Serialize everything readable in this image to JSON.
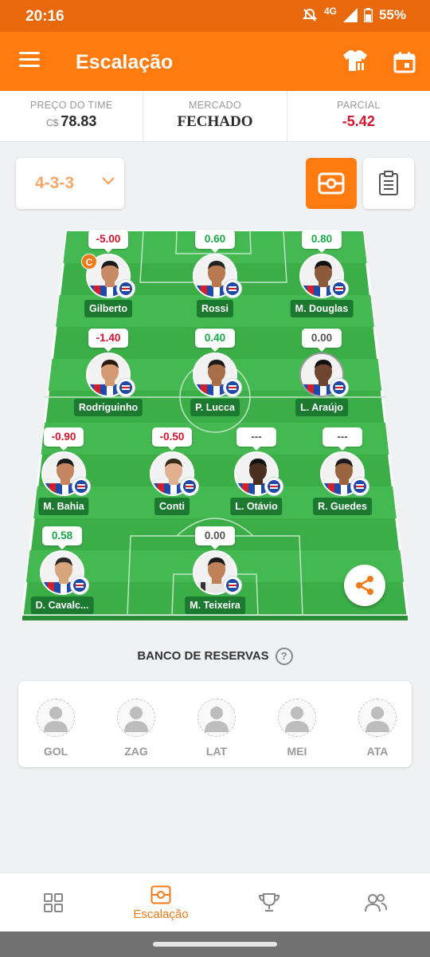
{
  "status": {
    "time": "20:16",
    "network": "4G",
    "battery": "55%"
  },
  "appbar": {
    "title": "Escalação"
  },
  "info": {
    "price_label": "PREÇO DO TIME",
    "price_currency": "C$",
    "price_value": "78.83",
    "market_label": "MERCADO",
    "market_value": "FECHADO",
    "partial_label": "PARCIAL",
    "partial_value": "-5.42"
  },
  "formation": {
    "value": "4-3-3"
  },
  "players": [
    {
      "name": "Gilberto",
      "score": "-5.00",
      "tone": "neg",
      "captain": "C"
    },
    {
      "name": "Rossi",
      "score": "0.60",
      "tone": "pos"
    },
    {
      "name": "M. Douglas",
      "score": "0.80",
      "tone": "pos"
    },
    {
      "name": "Rodriguinho",
      "score": "-1.40",
      "tone": "neg"
    },
    {
      "name": "P. Lucca",
      "score": "0.40",
      "tone": "pos"
    },
    {
      "name": "L. Araújo",
      "score": "0.00",
      "tone": "nil"
    },
    {
      "name": "M. Bahia",
      "score": "-0.90",
      "tone": "neg"
    },
    {
      "name": "Conti",
      "score": "-0.50",
      "tone": "neg"
    },
    {
      "name": "L. Otávio",
      "score": "---",
      "tone": "nil"
    },
    {
      "name": "R. Guedes",
      "score": "---",
      "tone": "nil"
    },
    {
      "name": "D. Cavalc...",
      "score": "0.58",
      "tone": "pos"
    },
    {
      "name": "M. Teixeira",
      "score": "0.00",
      "tone": "nil"
    }
  ],
  "bench": {
    "title": "BANCO DE RESERVAS",
    "help": "?",
    "slots": [
      "GOL",
      "ZAG",
      "LAT",
      "MEI",
      "ATA"
    ]
  },
  "nav": {
    "active_label": "Escalação"
  },
  "colors": {
    "accent": "#ff7a0f",
    "pitch": "#3fb34b",
    "positive": "#18a847",
    "negative": "#d2142c"
  },
  "icons": [
    "menu-icon",
    "shirt-icon",
    "calendar-icon",
    "chevron-down-icon",
    "field-view-icon",
    "clipboard-icon",
    "share-icon",
    "help-icon",
    "grid-icon",
    "trophy-icon",
    "people-icon"
  ]
}
